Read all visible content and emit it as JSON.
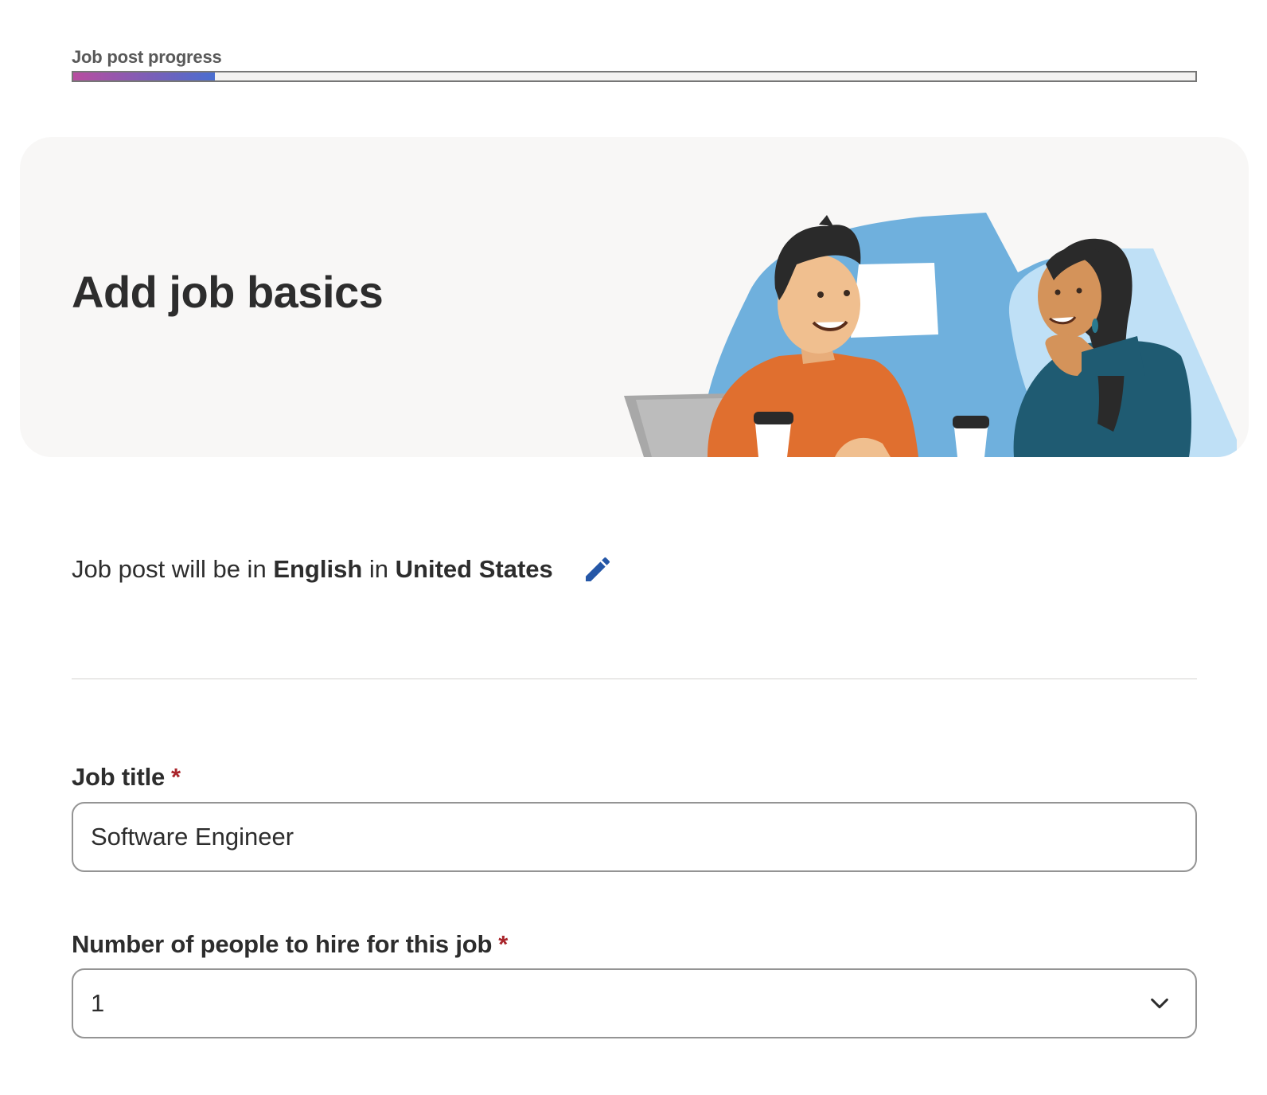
{
  "progress": {
    "label": "Job post progress",
    "percent": 12.6,
    "gradient_colors": [
      "#b84da0",
      "#7a5fb8",
      "#4a6ed0"
    ]
  },
  "hero": {
    "title": "Add job basics",
    "illustration_icon": "two-people-chatting-illustration"
  },
  "locale": {
    "prefix": "Job post will be in",
    "language": "English",
    "connector": "in",
    "country": "United States",
    "edit_icon": "pencil-icon"
  },
  "form": {
    "job_title": {
      "label": "Job title",
      "required_mark": "*",
      "value": "Software Engineer"
    },
    "hire_count": {
      "label": "Number of people to hire for this job",
      "required_mark": "*",
      "value": "1",
      "icon": "chevron-down-icon"
    }
  },
  "colors": {
    "text": "#2d2d2d",
    "required": "#a9252b",
    "accent_blue": "#2557a7",
    "hero_bg": "#f8f7f6"
  }
}
